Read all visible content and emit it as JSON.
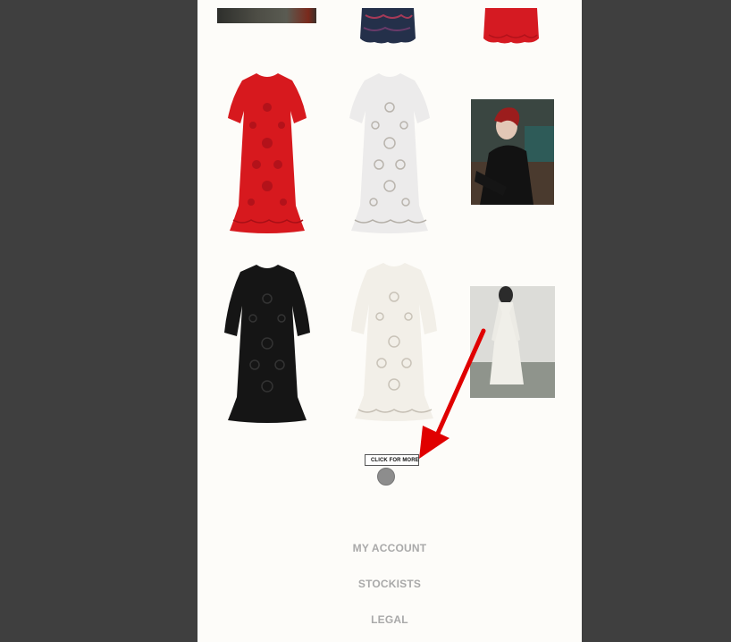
{
  "products": {
    "more_button_label": "CLICK FOR MORE",
    "items": [
      {
        "name": "Red broderie anglaise long dress",
        "color": "#d7191e"
      },
      {
        "name": "White broderie anglaise long dress",
        "color": "#ecebeb"
      },
      {
        "name": "Black broderie anglaise long dress",
        "color": "#151515"
      },
      {
        "name": "Ivory broderie anglaise long dress",
        "color": "#f2efe8"
      }
    ]
  },
  "footer": {
    "links": [
      "MY ACCOUNT",
      "STOCKISTS",
      "LEGAL"
    ]
  },
  "colors": {
    "page_bg": "#fdfcf9",
    "outer_bg": "#3f3f3f",
    "annotation_arrow": "#e00000",
    "footer_text": "#a9a9a9"
  }
}
